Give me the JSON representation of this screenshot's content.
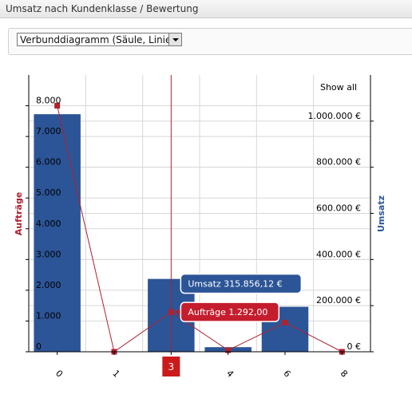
{
  "panel": {
    "title": "Umsatz nach Kundenklasse / Bewertung"
  },
  "toolbar": {
    "chart_type_value": "Verbunddiagramm (Säule, Linie)"
  },
  "chart_data": {
    "type": "bar+line",
    "categories": [
      "0",
      "1",
      "3",
      "4",
      "6",
      "8"
    ],
    "left_axis": {
      "label": "Aufträge",
      "ylim": [
        0,
        9000
      ],
      "ticks": [
        "0",
        "1.000",
        "2.000",
        "3.000",
        "4.000",
        "5.000",
        "6.000",
        "7.000",
        "8.000"
      ]
    },
    "right_axis": {
      "label": "Umsatz",
      "ylim": [
        0,
        1200000
      ],
      "ticks": [
        "0 €",
        "200.000 €",
        "400.000 €",
        "600.000 €",
        "800.000 €",
        "1.000.000 €"
      ]
    },
    "series": [
      {
        "name": "Umsatz",
        "type": "bar",
        "axis": "right",
        "color": "#2c5597",
        "values": [
          1030000,
          0,
          315856.12,
          20000,
          195000,
          0
        ]
      },
      {
        "name": "Aufträge",
        "type": "line",
        "axis": "left",
        "color": "#b0212e",
        "values": [
          8000,
          0,
          1292,
          50,
          950,
          0
        ]
      }
    ],
    "show_all_label": "Show all",
    "grid": true,
    "crosshair": {
      "category": "3",
      "label": "3"
    },
    "tooltips": {
      "bar": "Umsatz 315.856,12 €",
      "line": "Aufträge 1.292,00"
    },
    "colors": {
      "bar": "#2c5597",
      "line": "#b0212e",
      "grid": "#d8d8d8"
    }
  }
}
